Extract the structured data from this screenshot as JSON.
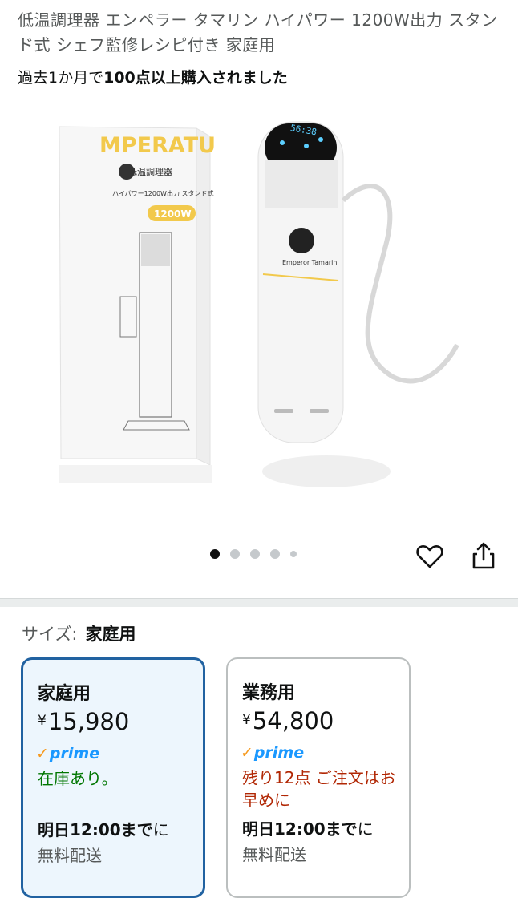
{
  "product": {
    "title": "低温調理器 エンペラー タマリン ハイパワー 1200W出力 スタンド式 シェフ監修レシピ付き 家庭用",
    "bought_prefix": "過去1か月で",
    "bought_count": "100点以上購入されました",
    "image": {
      "box_brand": "MPERATU",
      "box_label": "低温調理器",
      "box_tagline": "ハイパワー1200W出力 スタンド式",
      "box_badge": "1200W",
      "device_display": "56:38",
      "logo_text": "Emperor Tamarin"
    }
  },
  "carousel": {
    "total_dots": 5,
    "active_index": 0
  },
  "icons": {
    "favorite": "heart-icon",
    "share": "share-icon"
  },
  "size": {
    "label": "サイズ:",
    "selected": "家庭用",
    "options": [
      {
        "name": "家庭用",
        "currency": "¥",
        "price": "15,980",
        "prime": "prime",
        "stock": "在庫あり。",
        "delivery_bold": "明日12:00まで",
        "delivery_rest": "に",
        "fee": "無料配送"
      },
      {
        "name": "業務用",
        "currency": "¥",
        "price": "54,800",
        "prime": "prime",
        "stock": "残り12点 ご注文はお早めに",
        "delivery_bold": "明日12:00まで",
        "delivery_rest": "に",
        "fee": "無料配送"
      }
    ]
  },
  "colors": {
    "prime_blue": "#1a98ff",
    "prime_check": "#f69a1f",
    "in_stock": "#007600",
    "low_stock": "#b12704",
    "selected_border": "#2162a1",
    "selected_bg": "#edf6fd"
  }
}
